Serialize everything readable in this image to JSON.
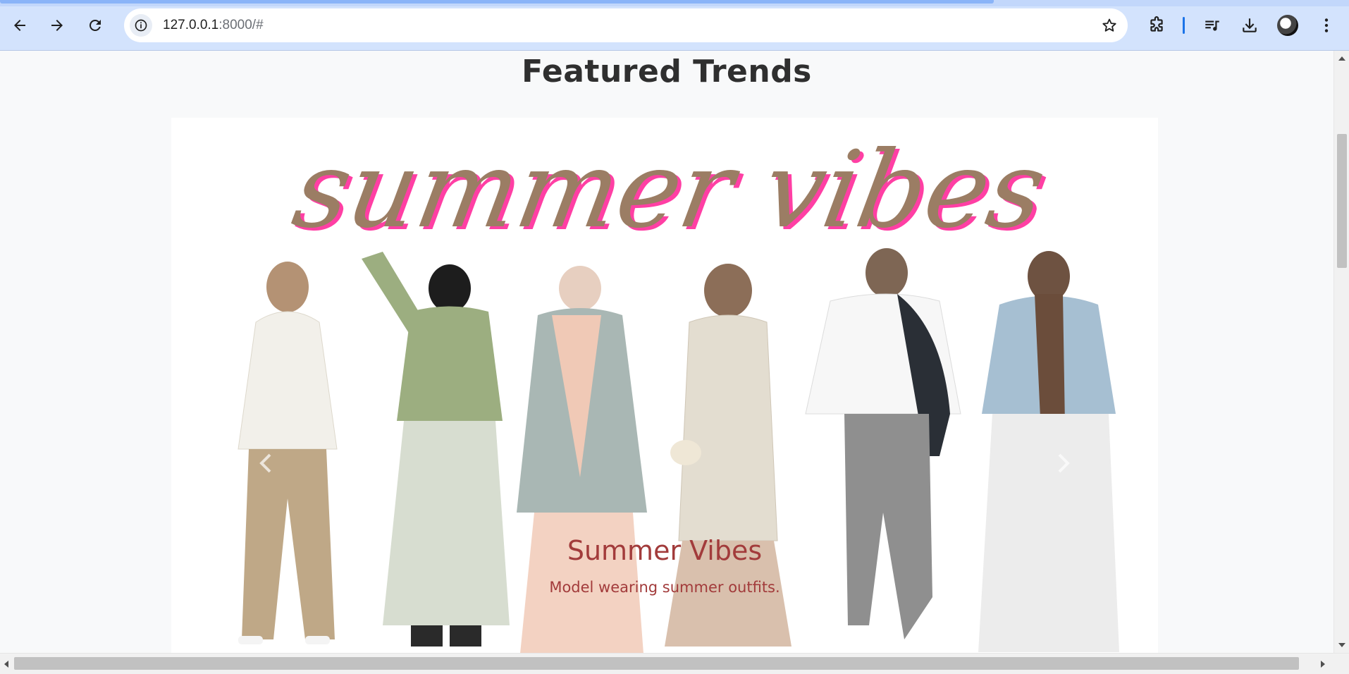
{
  "browser": {
    "url_host": "127.0.0.1",
    "url_rest": ":8000/#",
    "icons": {
      "back": "back-arrow-icon",
      "forward": "forward-arrow-icon",
      "reload": "reload-icon",
      "site_info": "info-icon",
      "bookmark": "star-icon",
      "extensions": "puzzle-icon",
      "media": "media-queue-icon",
      "downloads": "download-icon",
      "profile": "avatar",
      "menu": "kebab-menu-icon"
    }
  },
  "page": {
    "section_title": "Featured Trends",
    "carousel": {
      "slide": {
        "banner_text": "summer vibes",
        "caption_title": "Summer Vibes",
        "caption_text": "Model wearing summer outfits."
      },
      "colors": {
        "banner_fill": "#9b7d64",
        "banner_shadow": "#ff3fa4",
        "caption": "#a23b3b"
      }
    }
  }
}
